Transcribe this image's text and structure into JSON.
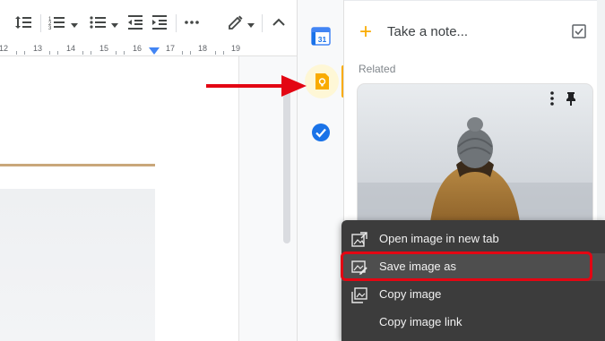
{
  "docs": {
    "toolbar": {
      "icons": [
        "line-spacing-icon",
        "numbered-list-icon",
        "bulleted-list-icon",
        "decrease-indent-icon",
        "increase-indent-icon",
        "more-icon",
        "edit-mode-icon",
        "collapse-icon"
      ]
    },
    "ruler": {
      "numbers": [
        "12",
        "13",
        "14",
        "15",
        "16",
        "17",
        "18",
        "19"
      ]
    }
  },
  "rail": {
    "calendar_day": "31",
    "active_color": "#f9ab00"
  },
  "keep": {
    "take_note_label": "Take a note...",
    "related_label": "Related",
    "card_image_desc_icon": "person-photo"
  },
  "context_menu": {
    "items": [
      {
        "label": "Open image in new tab",
        "icon": "open-image-icon"
      },
      {
        "label": "Save image as",
        "icon": "save-image-icon",
        "highlighted": true
      },
      {
        "label": "Copy image",
        "icon": "copy-image-icon"
      },
      {
        "label": "Copy image link",
        "icon": ""
      }
    ]
  },
  "colors": {
    "accent_yellow": "#f9ab00",
    "annotation_red": "#e30613",
    "menu_bg": "#3c3c3c"
  }
}
